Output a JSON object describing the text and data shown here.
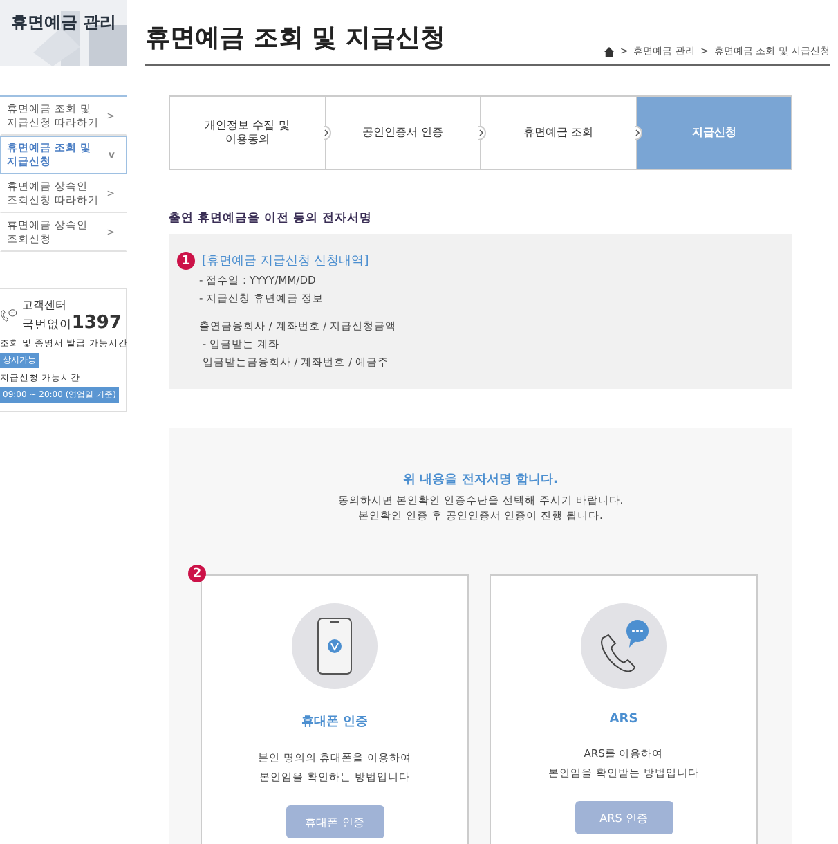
{
  "sidebar": {
    "title": "휴면예금 관리",
    "items": [
      {
        "label": "휴면예금 조회 및\n지급신청 따라하기",
        "marker": ">",
        "selected": false
      },
      {
        "label": "휴면예금 조회 및\n지급신청",
        "marker": "v",
        "selected": true
      },
      {
        "label": "휴면예금 상속인\n조회신청 따라하기",
        "marker": ">",
        "selected": false
      },
      {
        "label": "휴면예금 상속인\n조회신청",
        "marker": ">",
        "selected": false
      }
    ],
    "contact": {
      "label": "고객센터",
      "number_prefix": "국번없이",
      "number": "1397",
      "hours": [
        {
          "label": "조회 및 증명서 발급 가능시간",
          "value": "상시가능"
        },
        {
          "label": "지급신청 가능시간",
          "value": "09:00 ~ 20:00 (영업일 기준)"
        }
      ]
    }
  },
  "page": {
    "title": "휴면예금 조회 및 지급신청",
    "breadcrumb": [
      "휴면예금 관리",
      "휴면예금 조회 및 지급신청"
    ]
  },
  "steps": [
    {
      "label": "개인정보 수집 및\n이용동의",
      "selected": false
    },
    {
      "label": "공인인증서 인증",
      "selected": false
    },
    {
      "label": "휴면예금 조회",
      "selected": false
    },
    {
      "label": "지급신청",
      "selected": true
    }
  ],
  "section_title": "출연 휴면예금을 이전 등의 전자서명",
  "details": {
    "badge": "1",
    "heading": "[휴면예금 지급신청 신청내역]",
    "lines": [
      "- 접수일 : YYYY/MM/DD",
      "- 지급신청 휴면예금 정보"
    ],
    "sublines": [
      "출연금융회사 / 계좌번호 / 지급신청금액",
      " - 입금받는 계좌",
      " 입금받는금융회사 / 계좌번호 / 예금주"
    ]
  },
  "sign": {
    "heading": "위 내용을 전자서명 합니다.",
    "lines": [
      "동의하시면 본인확인 인증수단을 선택해 주시기 바랍니다.",
      "본인확인 인증 후 공인인증서 인증이 진행 됩니다."
    ],
    "badge": "2",
    "methods": [
      {
        "kind": "phone",
        "title": "휴대폰 인증",
        "description": "본인 명의의 휴대폰을 이용하여\n본인임을 확인하는 방법입니다",
        "button": "휴대폰 인증"
      },
      {
        "kind": "ars",
        "title": "ARS",
        "description": "ARS를 이용하여\n본인임을 확인받는 방법입니다",
        "button": "ARS 인증"
      }
    ]
  }
}
